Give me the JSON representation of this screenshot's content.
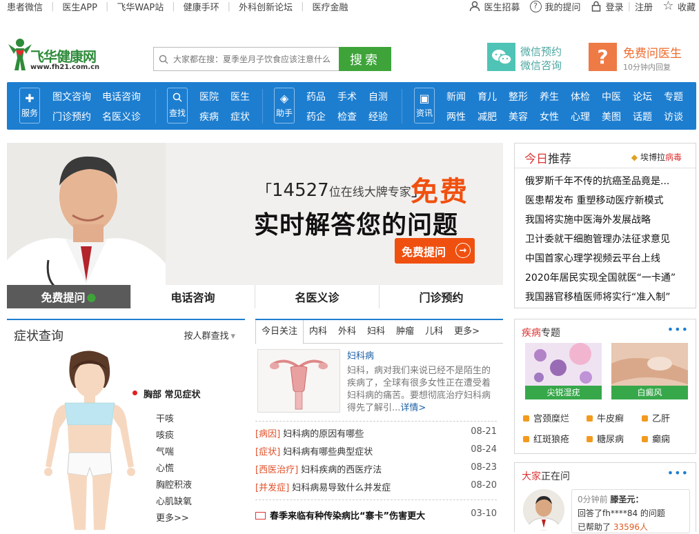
{
  "topbar": {
    "left": [
      "患者微信",
      "医生APP",
      "飞华WAP站",
      "健康手环",
      "外科创新论坛",
      "医疗金融"
    ],
    "right": [
      {
        "label": "医生招募",
        "icon": "doctor-icon"
      },
      {
        "label": "我的提问",
        "icon": "question-icon"
      },
      {
        "label": "登录",
        "icon": "lock-icon"
      },
      {
        "label": "注册",
        "icon": ""
      },
      {
        "label": "收藏",
        "icon": "star-icon"
      }
    ]
  },
  "logo": {
    "name": "飞华健康网",
    "url": "www.fh21.com.cn"
  },
  "search": {
    "placeholder": "大家都在搜：夏季坐月子饮食应该注意什么",
    "button": "搜索"
  },
  "wechat": {
    "line1": "微信预约",
    "line2": "微信咨询"
  },
  "ask": {
    "title": "免费问医生",
    "subtitle": "10分钟内回复"
  },
  "nav": {
    "groups": [
      {
        "icon": "服务",
        "links": [
          [
            "图文咨询",
            "电话咨询"
          ],
          [
            "门诊预约",
            "名医义诊"
          ]
        ]
      },
      {
        "icon": "查找",
        "links": [
          [
            "医院",
            "医生"
          ],
          [
            "疾病",
            "症状"
          ]
        ]
      },
      {
        "icon": "助手",
        "links": [
          [
            "药品",
            "手术",
            "自测"
          ],
          [
            "药企",
            "检查",
            "经验"
          ]
        ]
      },
      {
        "icon": "资讯",
        "links": [
          [
            "新闻",
            "育儿",
            "整形",
            "养生",
            "体检",
            "中医",
            "论坛",
            "专题"
          ],
          [
            "两性",
            "减肥",
            "美容",
            "女性",
            "心理",
            "美图",
            "话题",
            "访谈"
          ]
        ]
      }
    ]
  },
  "banner": {
    "count": "14527",
    "count_suffix": "位在线大牌专家",
    "free": "免费",
    "headline": "实时解答您的问题",
    "button": "免费提问",
    "tabs": [
      "免费提问",
      "电话咨询",
      "名医义诊",
      "门诊预约"
    ]
  },
  "today": {
    "title_a": "今日",
    "title_b": "推荐",
    "ebola_a": "埃博拉",
    "ebola_b": "病毒",
    "items": [
      "俄罗斯千年不传的抗癌圣品竟是...",
      "医患帮发布 重塑移动医疗新模式",
      "我国将实施中医海外发展战略",
      "卫计委就干细胞管理办法征求意见",
      "中国首家心理学视频云平台上线",
      "2020年居民实现全国就医“一卡通”",
      "我国器官移植医师将实行“准入制”"
    ]
  },
  "symptoms": {
    "title": "症状查询",
    "crowd": "按人群查找",
    "section": "胸部 常见症状",
    "items": [
      "干咳",
      "咳痰",
      "气喘",
      "心慌",
      "胸腔积液",
      "心肌缺氧",
      "更多>>"
    ]
  },
  "news": {
    "tabs": [
      "今日关注",
      "内科",
      "外科",
      "妇科",
      "肿瘤",
      "儿科",
      "更多>"
    ],
    "article": {
      "title": "妇科病",
      "summary": "妇科，病对我们来说已经不是陌生的疾病了，全球有很多女性正在遭受着妇科病的痛苦。要想彻底治疗妇科病得先了解引...",
      "more": "详情>"
    },
    "list": [
      {
        "cat": "[病因]",
        "title": "妇科病的原因有哪些",
        "date": "08-21"
      },
      {
        "cat": "[症状]",
        "title": "妇科病有哪些典型症状",
        "date": "08-24"
      },
      {
        "cat": "[西医治疗]",
        "title": "妇科疾病的西医疗法",
        "date": "08-23"
      },
      {
        "cat": "[并发症]",
        "title": "妇科病易导致什么并发症",
        "date": "08-20"
      }
    ],
    "headline": {
      "title": "春季来临有种传染病比“寨卡”伤害更大",
      "date": "03-10"
    }
  },
  "tumor": {
    "title_a": "疾病",
    "title_b": "专题",
    "images": [
      "尖锐湿疣",
      "白癜风"
    ],
    "links": [
      "宫颈糜烂",
      "牛皮癣",
      "乙肝",
      "红斑狼疮",
      "糖尿病",
      "癫痫"
    ]
  },
  "people": {
    "title_a": "大家",
    "title_b": "正在问",
    "time": "0分钟前",
    "doctor": "滕圣元：",
    "answer": "回答了fh****84 的问题",
    "helped_label": "已帮助了",
    "helped": "33596人"
  }
}
